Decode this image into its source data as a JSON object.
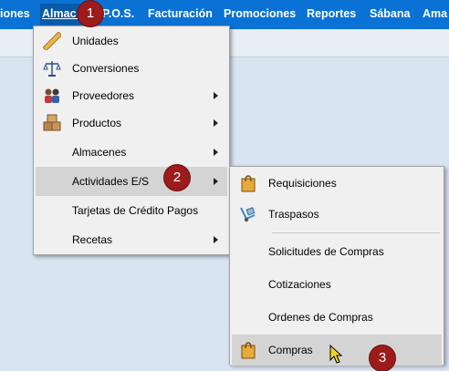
{
  "menubar": {
    "items": [
      "iones",
      "Almacén",
      "P.O.S.",
      "Facturación",
      "Promociones",
      "Reportes",
      "Sábana",
      "Ama"
    ],
    "active": "Almacén"
  },
  "almacen_menu": {
    "items": [
      {
        "label": "Unidades",
        "icon": "ruler-icon",
        "submenu": false
      },
      {
        "label": "Conversiones",
        "icon": "balance-scale-icon",
        "submenu": false
      },
      {
        "label": "Proveedores",
        "icon": "suppliers-icon",
        "submenu": true
      },
      {
        "label": "Productos",
        "icon": "boxes-icon",
        "submenu": true
      },
      {
        "label": "Almacenes",
        "icon": "",
        "submenu": true
      },
      {
        "label": "Actividades E/S",
        "icon": "",
        "submenu": true,
        "highlighted": true
      },
      {
        "label": "Tarjetas de Crédito Pagos",
        "icon": "",
        "submenu": false
      },
      {
        "label": "Recetas",
        "icon": "",
        "submenu": true
      }
    ]
  },
  "actividades_menu": {
    "items": [
      {
        "label": "Requisiciones",
        "icon": "shopping-bag-icon"
      },
      {
        "label": "Traspasos",
        "icon": "hand-truck-icon"
      },
      {
        "label": "Solicitudes de Compras",
        "icon": ""
      },
      {
        "label": "Cotizaciones",
        "icon": ""
      },
      {
        "label": "Ordenes de Compras",
        "icon": ""
      },
      {
        "label": "Compras",
        "icon": "shopping-bag-icon",
        "highlighted": true
      }
    ]
  },
  "step_badges": [
    "1",
    "2",
    "3"
  ],
  "colors": {
    "menubar": "#0a72d4",
    "badge": "#9d1b1b",
    "menu_bg": "#f0f0f0",
    "highlight": "#d4d4d4"
  }
}
